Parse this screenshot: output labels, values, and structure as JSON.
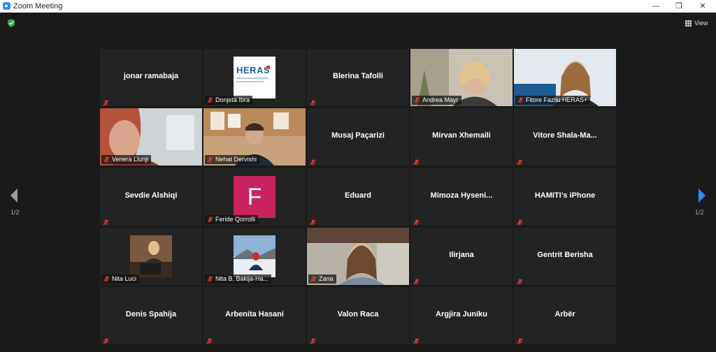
{
  "window": {
    "title": "Zoom Meeting",
    "minimize": "—",
    "restore": "❐",
    "close": "✕"
  },
  "toolbar": {
    "view_label": "View"
  },
  "pagination": {
    "left_label": "1/2",
    "right_label": "1/2"
  },
  "colors": {
    "accent": "#2d8cff",
    "active_speaker": "#c8e24a",
    "muted": "#e23b3b",
    "shield": "#2fa84f"
  },
  "participants": [
    {
      "name": "jonar ramabaja",
      "kind": "name"
    },
    {
      "name": "Donjeta Ibra",
      "kind": "logo-heras",
      "logo_text": "HERAS"
    },
    {
      "name": "Blerina Tafolli",
      "kind": "name"
    },
    {
      "name": "Andrea Mayr",
      "kind": "video"
    },
    {
      "name": "Fitore Fazliu HERAS+",
      "kind": "video"
    },
    {
      "name": "Venera Llunji",
      "kind": "video"
    },
    {
      "name": "Nehat Dervishi",
      "kind": "video"
    },
    {
      "name": "Musaj Paçarizi",
      "kind": "name"
    },
    {
      "name": "Mirvan Xhemaili",
      "kind": "name"
    },
    {
      "name": "Vitore  Shala-Ma...",
      "kind": "name"
    },
    {
      "name": "Sevdie Alshiqi",
      "kind": "name"
    },
    {
      "name": "Feride Qorrolli",
      "kind": "logo-f",
      "logo_text": "F"
    },
    {
      "name": "Eduard",
      "kind": "name"
    },
    {
      "name": "Mimoza  Hyseni...",
      "kind": "name"
    },
    {
      "name": "HAMITI’s iPhone",
      "kind": "name"
    },
    {
      "name": "Nita Luci",
      "kind": "thumb"
    },
    {
      "name": "Nita B. Bakija-Ha...",
      "kind": "thumb"
    },
    {
      "name": "Zana",
      "kind": "video",
      "active": true
    },
    {
      "name": "Ilirjana",
      "kind": "name"
    },
    {
      "name": "Gentrit Berisha",
      "kind": "name"
    },
    {
      "name": "Denis Spahija",
      "kind": "name"
    },
    {
      "name": "Arbenita Hasani",
      "kind": "name"
    },
    {
      "name": "Valon Raca",
      "kind": "name"
    },
    {
      "name": "Argjira Juniku",
      "kind": "name"
    },
    {
      "name": "Arbër",
      "kind": "name"
    }
  ]
}
